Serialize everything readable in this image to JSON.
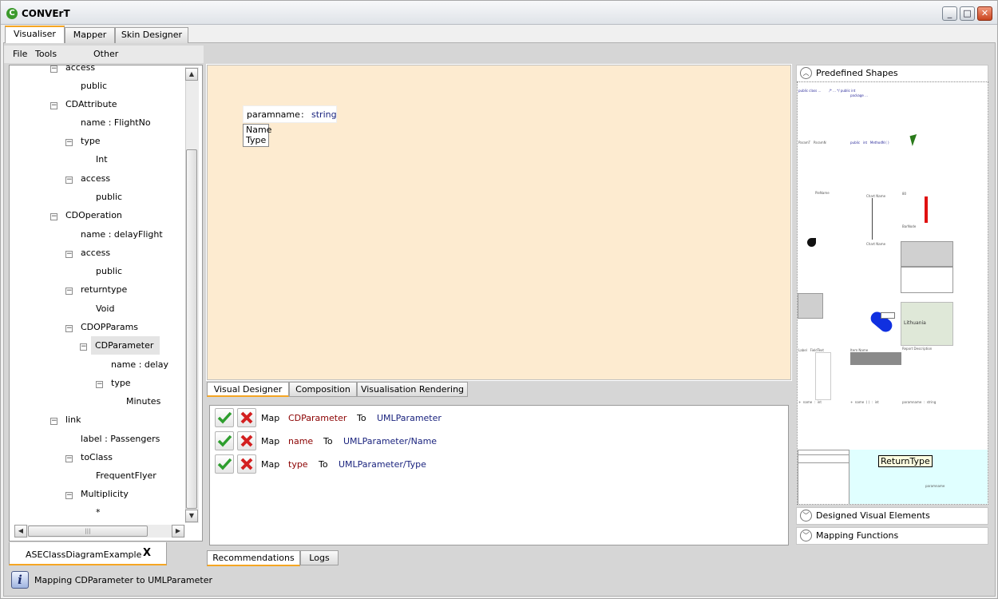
{
  "app": {
    "title": "CONVErT",
    "icon": "C",
    "minimize": "_",
    "maximize": "□",
    "close": "✕"
  },
  "top_tabs": [
    "Visualiser",
    "Mapper",
    "Skin Designer"
  ],
  "menu": [
    "File",
    "Tools",
    "Other"
  ],
  "tree": [
    {
      "label": "access",
      "toggle": "⊟"
    },
    {
      "label": "public"
    },
    {
      "label": "CDAttribute",
      "toggle": "⊟"
    },
    {
      "label": "name : FlightNo"
    },
    {
      "label": "type",
      "toggle": "⊟"
    },
    {
      "label": "Int"
    },
    {
      "label": "access",
      "toggle": "⊟"
    },
    {
      "label": "public"
    },
    {
      "label": "CDOperation",
      "toggle": "⊟"
    },
    {
      "label": "name : delayFlight"
    },
    {
      "label": "access",
      "toggle": "⊟"
    },
    {
      "label": "public"
    },
    {
      "label": "returntype",
      "toggle": "⊟"
    },
    {
      "label": "Void"
    },
    {
      "label": "CDOPParams",
      "toggle": "⊟"
    },
    {
      "label": "CDParameter",
      "toggle": "⊟"
    },
    {
      "label": "name : delay"
    },
    {
      "label": "type",
      "toggle": "⊟"
    },
    {
      "label": "Minutes"
    },
    {
      "label": "link",
      "toggle": "⊟"
    },
    {
      "label": "label : Passengers"
    },
    {
      "label": "toClass",
      "toggle": "⊟"
    },
    {
      "label": "FrequentFlyer"
    },
    {
      "label": "Multiplicity",
      "toggle": "⊟"
    },
    {
      "label": "*"
    }
  ],
  "doc_tab": {
    "label": "ASEClassDiagramExample",
    "close": "X"
  },
  "status": {
    "icon": "i",
    "text": "Mapping CDParameter to UMLParameter"
  },
  "canvas": {
    "param_name": "paramname",
    "separator": ":",
    "param_type": "string",
    "row1": "Name",
    "row2": "Type"
  },
  "designer_tabs": [
    "Visual Designer",
    "Composition",
    "Visualisation Rendering"
  ],
  "recommendations": [
    {
      "verb": "Map",
      "source": "CDParameter",
      "to": "To",
      "target": "UMLParameter"
    },
    {
      "verb": "Map",
      "source": "name",
      "to": "To",
      "target": "UMLParameter/Name"
    },
    {
      "verb": "Map",
      "source": "type",
      "to": "To",
      "target": "UMLParameter/Type"
    }
  ],
  "bottom_tabs": [
    "Recommendations",
    "Logs"
  ],
  "right_panel": {
    "predefined": "Predefined Shapes",
    "designed": "Designed Visual Elements",
    "mapping": "Mapping Functions",
    "tooltip": "ReturnType",
    "chevron_up": "︿",
    "chevron_down": "﹀"
  },
  "colors": {
    "canvas": "#fdebd0",
    "accent": "#f5a623",
    "source_text": "#8b0000",
    "target_text": "#1a237e",
    "check": "#2e9e2e",
    "cross": "#d32020"
  }
}
